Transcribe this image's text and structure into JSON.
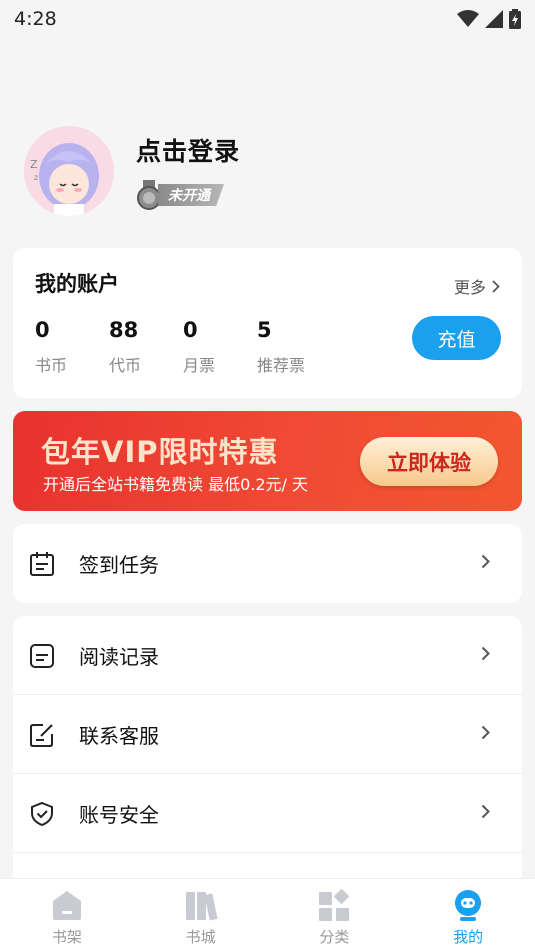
{
  "status_bar": {
    "time": "4:28"
  },
  "profile": {
    "login_text": "点击登录",
    "vip_status": "未开通"
  },
  "account": {
    "title": "我的账户",
    "more": "更多",
    "stats": [
      {
        "value": "0",
        "label": "书币"
      },
      {
        "value": "88",
        "label": "代币"
      },
      {
        "value": "0",
        "label": "月票"
      },
      {
        "value": "5",
        "label": "推荐票"
      }
    ],
    "recharge": "充值"
  },
  "vip_banner": {
    "title": "包年VIP限时特惠",
    "subtitle": "开通后全站书籍免费读 最低0.2元/ 天",
    "button": "立即体验"
  },
  "menu": {
    "checkin": {
      "label": "签到任务",
      "icon": "calendar-icon"
    },
    "items": [
      {
        "label": "阅读记录",
        "icon": "history-icon"
      },
      {
        "label": "联系客服",
        "icon": "edit-icon"
      },
      {
        "label": "账号安全",
        "icon": "shield-icon"
      }
    ]
  },
  "tabbar": {
    "tabs": [
      {
        "label": "书架",
        "icon": "bookshelf-icon"
      },
      {
        "label": "书城",
        "icon": "bookstore-icon"
      },
      {
        "label": "分类",
        "icon": "category-icon"
      },
      {
        "label": "我的",
        "icon": "profile-icon"
      }
    ],
    "active_index": 3
  },
  "colors": {
    "accent": "#1aa0ef",
    "vip_red": "#ec3b30",
    "vip_gold": "#f6c98c"
  }
}
